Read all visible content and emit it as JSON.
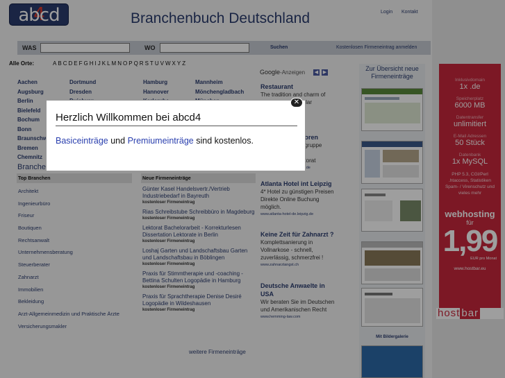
{
  "header": {
    "logo_main": "abcd",
    "logo_digit": "4",
    "title": "Branchenbuch Deutschland",
    "login": "Login",
    "contact": "Kontakt"
  },
  "search": {
    "was_label": "WAS",
    "wo_label": "WO",
    "was_value": "",
    "wo_value": "",
    "submit": "Suchen",
    "free_entry_link": "Kostenlosen Firmeneintrag anmelden"
  },
  "alpha": {
    "label": "Alle Orte:",
    "letters": [
      "A",
      "B",
      "C",
      "D",
      "E",
      "F",
      "G",
      "H",
      "I",
      "J",
      "K",
      "L",
      "M",
      "N",
      "O",
      "P",
      "Q",
      "R",
      "S",
      "T",
      "U",
      "V",
      "W",
      "X",
      "Y",
      "Z"
    ]
  },
  "cities": {
    "col1": [
      "Aachen",
      "Augsburg",
      "Berlin",
      "Bielefeld",
      "Bochum",
      "Bonn",
      "Braunschw",
      "Bremen",
      "Chemnitz"
    ],
    "col2": [
      "Dortmund",
      "Dresden",
      "Duisburg"
    ],
    "col3": [
      "Hamburg",
      "Hannover",
      "Karlsruhe"
    ],
    "col4": [
      "Mannheim",
      "Mönchengladbach",
      "München"
    ]
  },
  "branchen_heading": "Branche",
  "top_branchen": {
    "heading": "Top Branchen",
    "items": [
      "Architekt",
      "Ingenieurbüro",
      "Friseur",
      "Boutiquen",
      "Rechtsanwalt",
      "Unternehmensberatung",
      "Steuerberater",
      "Zahnarzt",
      "Immobilien",
      "Bekleidung",
      "Arzt-Allgemeinmedizin und Praktische Ärzte",
      "Versicherungsmakler"
    ]
  },
  "new_entries": {
    "heading": "Neue Firmeneinträge",
    "items": [
      {
        "name": "Günter Kasel Handelsvertr./Vertrieb Industriebedarf in Bayreuth",
        "sub": "kostenloser Firmeneintrag"
      },
      {
        "name": "Rias Schreibstube Schreibbüro in Magdeburg",
        "sub": "kostenloser Firmeneintrag"
      },
      {
        "name": "Lektorat Bachelorarbeit - Korrekturlesen Dissertation Lektorate in Berlin",
        "sub": "kostenloser Firmeneintrag"
      },
      {
        "name": "Loshaj Garten und Landschaftsbau Garten und Landschaftsbau in Böblingen",
        "sub": "kostenloser Firmeneintrag"
      },
      {
        "name": "Praxis für Stimmtherapie und -coaching - Bettina Schulten Logopädie in Hamburg",
        "sub": "kostenloser Firmeneintrag"
      },
      {
        "name": "Praxis für Sprachtherapie Denise Desiré Logopädie in Wildeshausen",
        "sub": "kostenloser Firmeneintrag"
      }
    ],
    "more": "weitere Firmeneinträge"
  },
  "ads": {
    "google": "Google",
    "label": "-Anzeigen",
    "items": [
      {
        "title": "Restaurant",
        "text": "The tradition and charm of",
        "text2": "tacular",
        "url": ""
      },
      {
        "title": "utoren",
        "text": "gsgruppe",
        "text2": "Ihr",
        "text3": "ektorat",
        "url": "rtsg.de"
      },
      {
        "title": "Atlanta Hotel int Leipzig",
        "text": "4* Hotel zu günstigen Preisen Direkte Online Buchung möglich.",
        "url": "www.atlanta-hotel-de.leipzig.de"
      },
      {
        "title": "Keine Zeit für Zahnarzt ?",
        "text": "Komplettsanierung in Vollnarkose - schnell, zuverlässig, schmerzfrei !",
        "url": "www.zahnarztangst.ch"
      },
      {
        "title": "Deutsche Anwaelte in USA",
        "text": "Wir beraten Sie im Deutschen und Amerikanischen Recht",
        "url": "www.hemming-law.com"
      }
    ]
  },
  "gallery": {
    "title": "Zur Übersicht neue Firmeneinträge",
    "link": "Mit Bildergalerie"
  },
  "hostbar": {
    "items": [
      {
        "k": "Inklusivdomain",
        "v": "1x .de"
      },
      {
        "k": "Speicherplatz",
        "v": "6000 MB"
      },
      {
        "k": "Datentransfer",
        "v": "unlimitiert"
      },
      {
        "k": "E-Mail Adressen",
        "v": "50 Stück"
      },
      {
        "k": "Datenbank",
        "v": "1x MySQL"
      }
    ],
    "features": "PHP 5.3, CGI/Perl .htaccess, Statistiken Spam- / Virenschutz und vieles mehr",
    "web": "webhosting",
    "fuer": "für",
    "price": "1,99",
    "per": "EUR pro Monat",
    "url": "www.hostbar.eu",
    "brand1": "host",
    "brand2": "bar"
  },
  "modal": {
    "title": "Herzlich Willkommen bei abcd4",
    "link1": "Basiceinträge",
    "and": "und",
    "link2": "Premiumeinträge",
    "suffix": "sind kostenlos.",
    "close": "✕"
  },
  "colors": {
    "brand_blue": "#2b3c6e",
    "hostbar_red": "#c9283c"
  }
}
